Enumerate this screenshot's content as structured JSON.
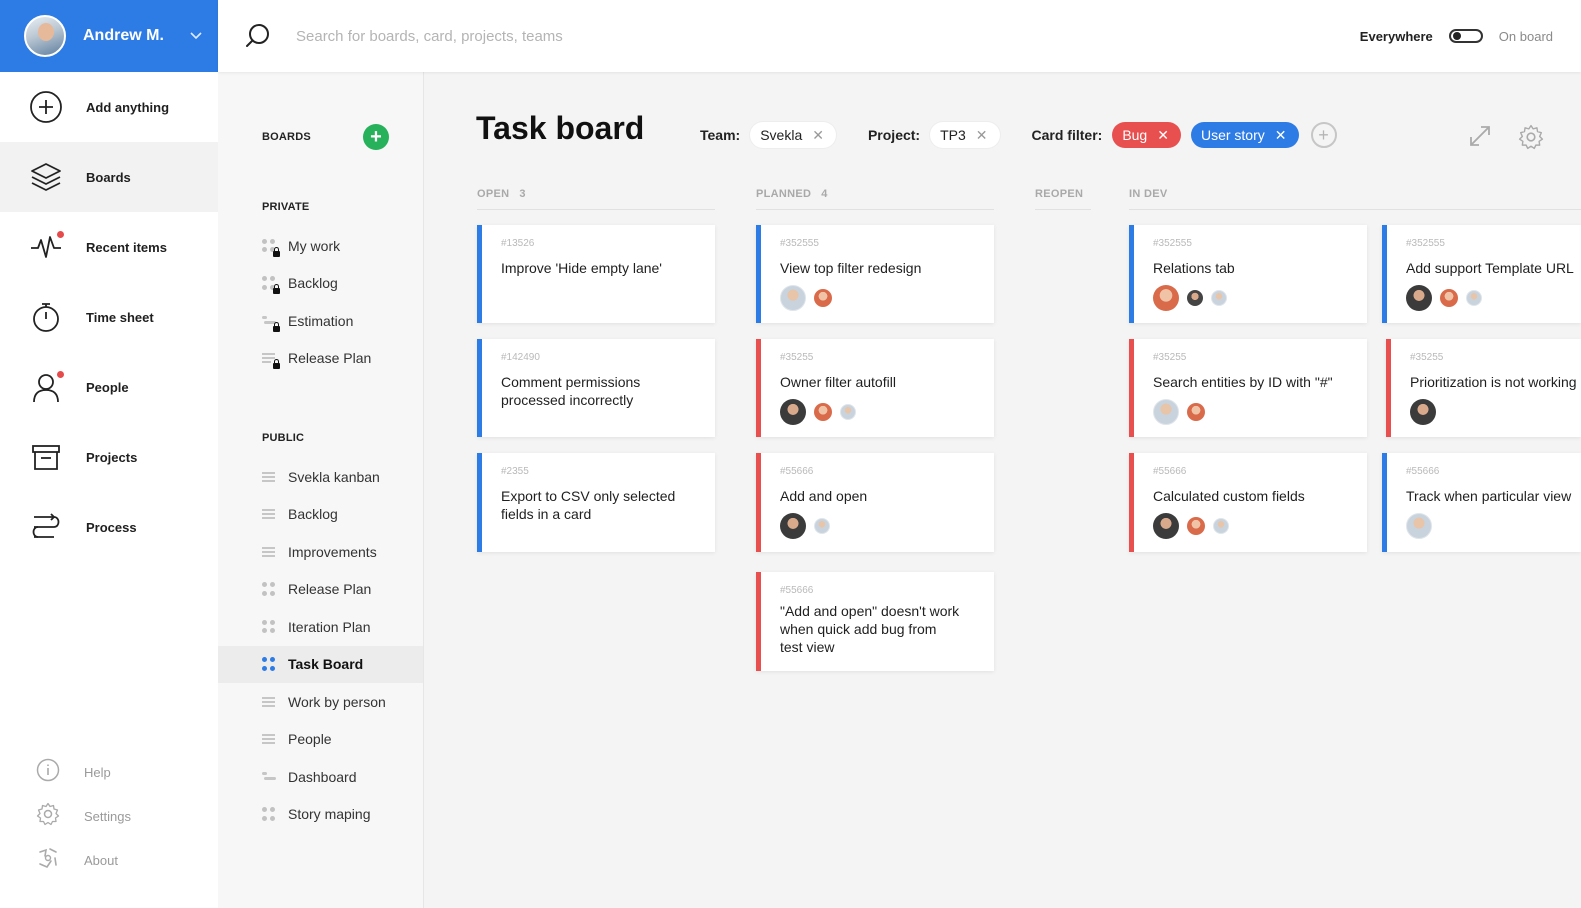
{
  "user": {
    "name": "Andrew M."
  },
  "search": {
    "placeholder": "Search for boards, card, projects, teams"
  },
  "scope": {
    "left": "Everywhere",
    "right": "On board"
  },
  "nav": {
    "items": [
      {
        "label": "Add anything",
        "icon": "plus-circle-icon"
      },
      {
        "label": "Boards",
        "icon": "layers-icon"
      },
      {
        "label": "Recent items",
        "icon": "activity-icon"
      },
      {
        "label": "Time sheet",
        "icon": "stopwatch-icon"
      },
      {
        "label": "People",
        "icon": "person-icon"
      },
      {
        "label": "Projects",
        "icon": "archive-box-icon"
      },
      {
        "label": "Process",
        "icon": "process-icon"
      }
    ],
    "bottom": [
      {
        "label": "Help",
        "icon": "info-icon"
      },
      {
        "label": "Settings",
        "icon": "gear-icon"
      },
      {
        "label": "About",
        "icon": "about-icon"
      }
    ]
  },
  "boards": {
    "title": "BOARDS",
    "private_title": "PRIVATE",
    "private": [
      "My work",
      "Backlog",
      "Estimation",
      "Release Plan"
    ],
    "public_title": "PUBLIC",
    "public": [
      "Svekla kanban",
      "Backlog",
      "Improvements",
      "Release Plan",
      "Iteration Plan",
      "Task Board",
      "Work by person",
      "People",
      "Dashboard",
      "Story maping"
    ]
  },
  "page": {
    "title": "Task board",
    "team_label": "Team:",
    "team_value": "Svekla",
    "project_label": "Project:",
    "project_value": "TP3",
    "card_filter_label": "Card filter:",
    "filters": [
      "Bug",
      "User story"
    ],
    "close_glyph": "✕",
    "add_glyph": "+"
  },
  "columns": [
    {
      "name": "OPEN",
      "count": "3"
    },
    {
      "name": "PLANNED",
      "count": "4"
    },
    {
      "name": "REOPEN",
      "count": ""
    },
    {
      "name": "IN DEV",
      "count": ""
    }
  ],
  "cards": {
    "open": [
      {
        "id": "#13526",
        "title": "Improve 'Hide empty lane'"
      },
      {
        "id": "#142490",
        "title": "Comment permissions\nprocessed incorrectly"
      },
      {
        "id": "#2355",
        "title": "Export to CSV only selected\nfields in a card"
      }
    ],
    "planned": [
      {
        "id": "#352555",
        "title": "View top filter redesign"
      },
      {
        "id": "#35255",
        "title": "Owner filter autofill"
      },
      {
        "id": "#55666",
        "title": "Add and open"
      },
      {
        "id": "#55666",
        "title": "\"Add and open\" doesn't work\nwhen quick add bug from\ntest view"
      }
    ],
    "indev_a": [
      {
        "id": "#352555",
        "title": "Relations tab"
      },
      {
        "id": "#35255",
        "title": "Search entities by ID with \"#\""
      },
      {
        "id": "#55666",
        "title": "Calculated custom fields"
      }
    ],
    "indev_b": [
      {
        "id": "#352555",
        "title": "Add support Template URL"
      },
      {
        "id": "#35255",
        "title": "Prioritization is not working"
      },
      {
        "id": "#55666",
        "title": "Track when particular view"
      }
    ]
  },
  "colors": {
    "accent": "#2d7be5",
    "bug": "#e85050",
    "add": "#27b15b"
  }
}
